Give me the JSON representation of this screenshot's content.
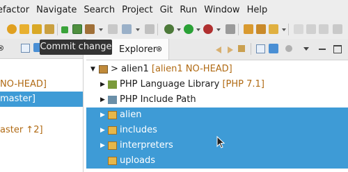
{
  "menubar": {
    "items": [
      "efactor",
      "Navigate",
      "Search",
      "Project",
      "Git",
      "Run",
      "Window",
      "Help"
    ]
  },
  "tooltip": {
    "text": "Commit change"
  },
  "left_panel": {
    "rows": [
      {
        "prefix": "",
        "text": "NO-HEAD]"
      },
      {
        "prefix": "",
        "text": "master]"
      },
      {
        "prefix": "",
        "text": "aster ↑2]"
      }
    ]
  },
  "explorer": {
    "title": "Explorer",
    "close_glyph": "⊗",
    "root": {
      "name": "> alien1",
      "branch": "[alien1 NO-HEAD]"
    },
    "items": [
      {
        "label": "PHP Language Library",
        "extra": "[PHP 7.1]"
      },
      {
        "label": "PHP Include Path",
        "extra": ""
      },
      {
        "label": "alien",
        "extra": ""
      },
      {
        "label": "includes",
        "extra": ""
      },
      {
        "label": "interpreters",
        "extra": ""
      },
      {
        "label": "uploads",
        "extra": ""
      }
    ]
  },
  "colors": {
    "selection": "#3e9bd6",
    "branch_text": "#b06a13",
    "tooltip_bg": "#333333"
  }
}
